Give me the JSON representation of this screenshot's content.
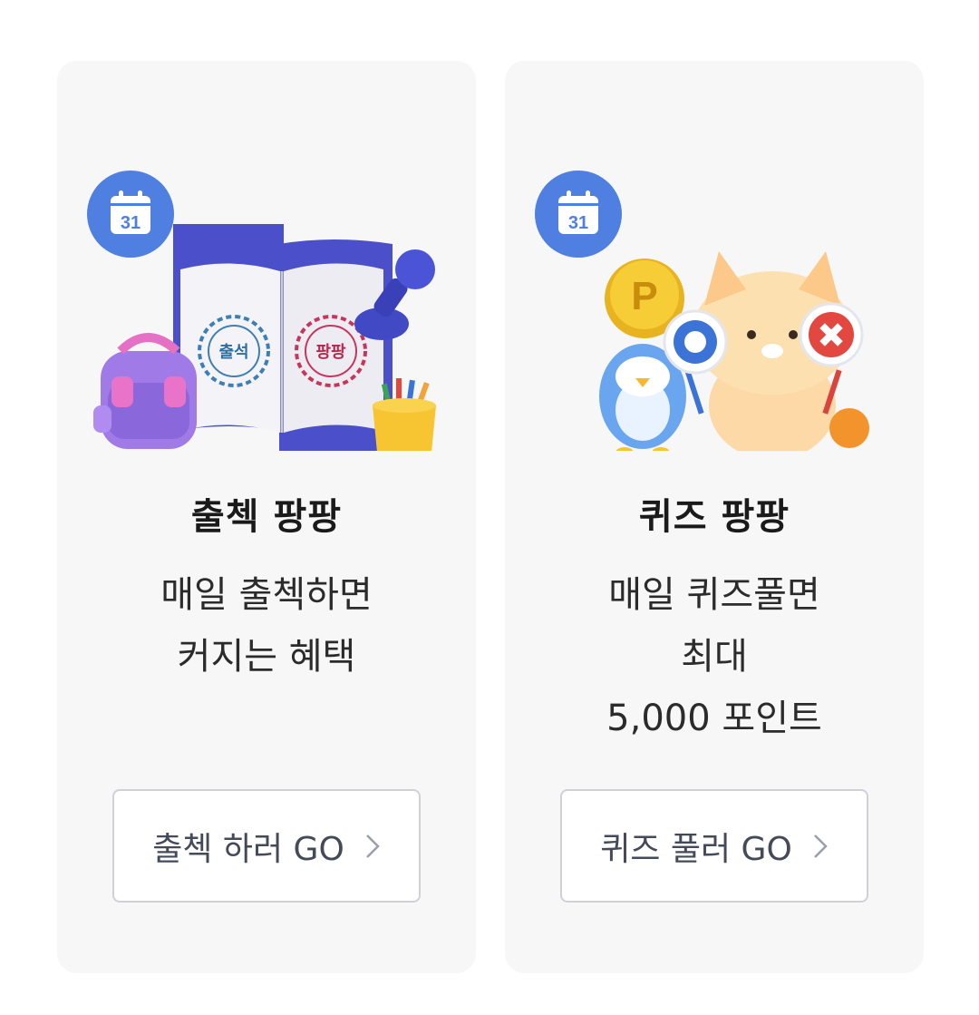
{
  "cards": [
    {
      "title": "출첵 팡팡",
      "description": [
        "매일 출첵하면",
        "커지는 혜택"
      ],
      "button_label": "출첵 하러 GO",
      "badge_icon": "calendar-icon",
      "badge_number": "31",
      "stamp_left": "출석",
      "stamp_right": "팡팡"
    },
    {
      "title": "퀴즈 팡팡",
      "description": [
        "매일 퀴즈풀면",
        "최대",
        "5,000 포인트"
      ],
      "button_label": "퀴즈 풀러 GO",
      "badge_icon": "calendar-icon",
      "badge_number": "31",
      "coin_letter": "P"
    }
  ],
  "colors": {
    "card_bg": "#f7f7f8",
    "badge": "#4f7fe0",
    "button_border": "#cfd1d6"
  }
}
